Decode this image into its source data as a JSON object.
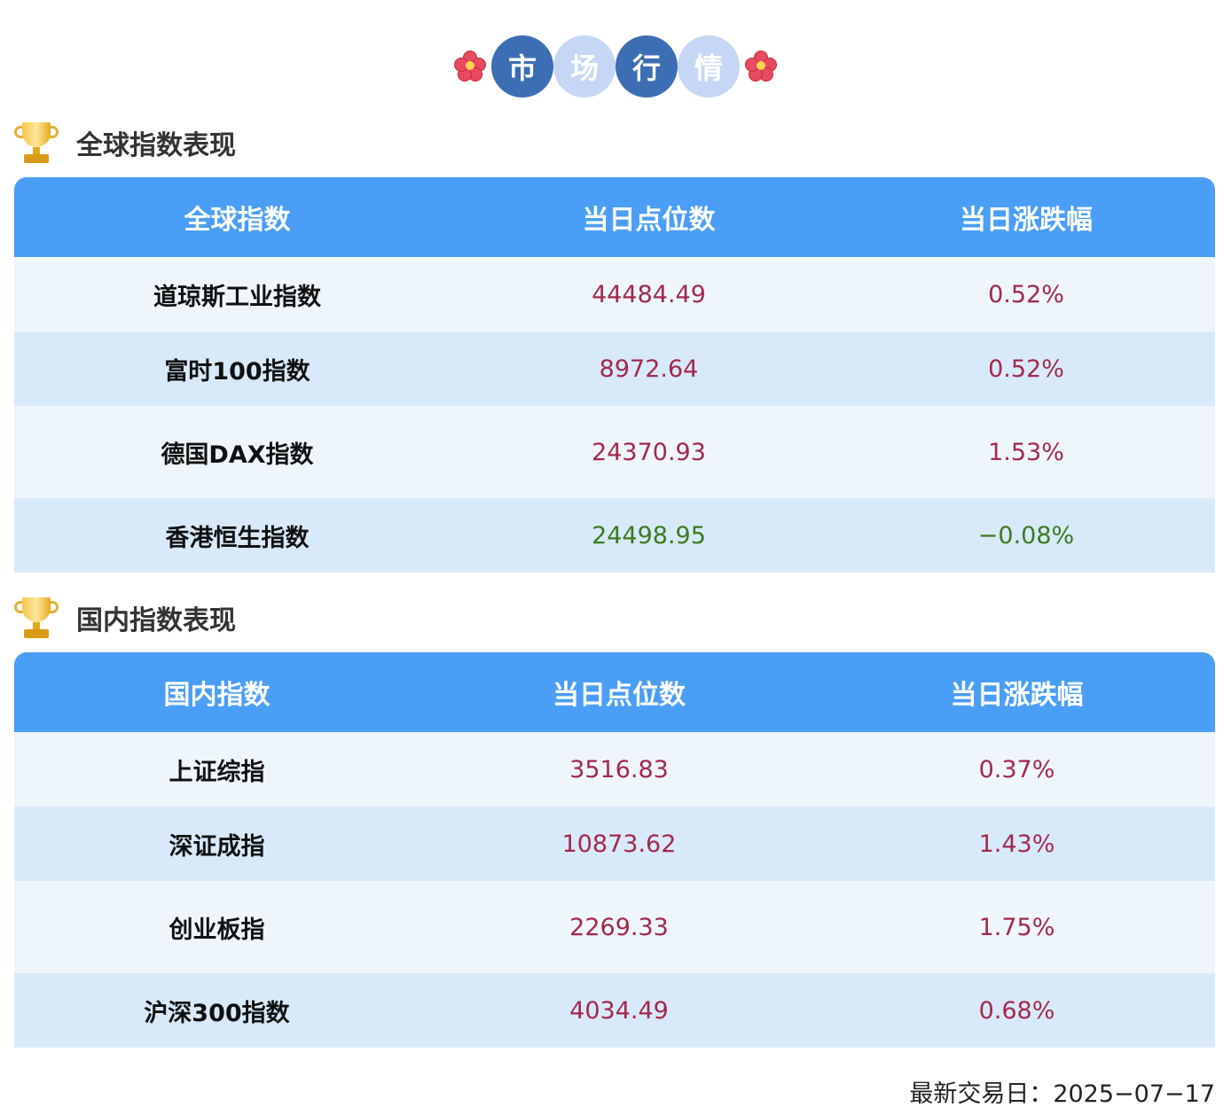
{
  "header": {
    "chars": [
      "市",
      "场",
      "行",
      "情"
    ]
  },
  "global": {
    "title": "全球指数表现",
    "columns": [
      "全球指数",
      "当日点位数",
      "当日涨跌幅"
    ],
    "rows": [
      {
        "name": "道琼斯工业指数",
        "points": "44484.49",
        "change": "0.52%",
        "trend": "up"
      },
      {
        "name": "富时100指数",
        "points": "8972.64",
        "change": "0.52%",
        "trend": "up"
      },
      {
        "name": "德国DAX指数",
        "points": "24370.93",
        "change": "1.53%",
        "trend": "up"
      },
      {
        "name": "香港恒生指数",
        "points": "24498.95",
        "change": "−0.08%",
        "trend": "down"
      }
    ]
  },
  "domestic": {
    "title": "国内指数表现",
    "columns": [
      "国内指数",
      "当日点位数",
      "当日涨跌幅"
    ],
    "rows": [
      {
        "name": "上证综指",
        "points": "3516.83",
        "change": "0.37%",
        "trend": "up"
      },
      {
        "name": "深证成指",
        "points": "10873.62",
        "change": "1.43%",
        "trend": "up"
      },
      {
        "name": "创业板指",
        "points": "2269.33",
        "change": "1.75%",
        "trend": "up"
      },
      {
        "name": "沪深300指数",
        "points": "4034.49",
        "change": "0.68%",
        "trend": "up"
      }
    ]
  },
  "footer": {
    "date_label": "最新交易日：2025−07−17"
  },
  "colors": {
    "header_blue": "#4a9ef5",
    "badge_dark": "#3d6db3",
    "badge_light": "#c5d7f4",
    "up": "#a3284c",
    "down": "#3b7a1e"
  }
}
